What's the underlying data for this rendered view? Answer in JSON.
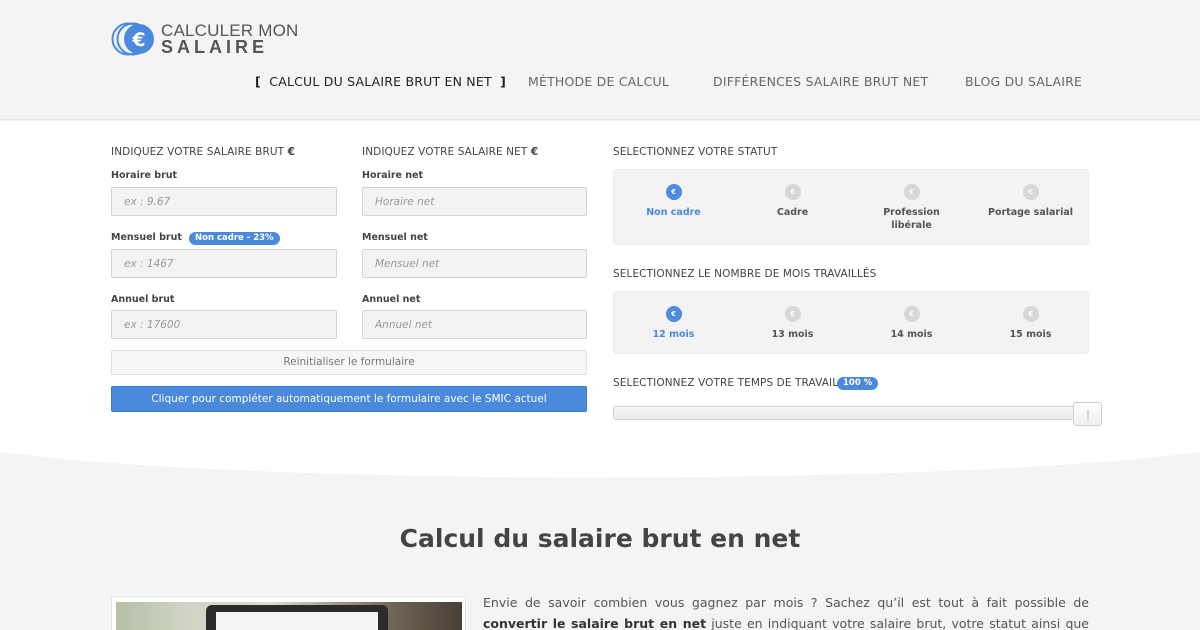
{
  "brand": {
    "line1": "CALCULER MON",
    "line2": "SALAIRE",
    "accent_color": "#4a89dc"
  },
  "nav": {
    "items": [
      {
        "label": "CALCUL DU SALAIRE BRUT EN NET",
        "active": true
      },
      {
        "label": "MÉTHODE DE CALCUL",
        "active": false
      },
      {
        "label": "DIFFÉRENCES SALAIRE BRUT NET",
        "active": false
      },
      {
        "label": "BLOG DU SALAIRE",
        "active": false
      }
    ],
    "bracket_open": "[",
    "bracket_close": "]"
  },
  "form": {
    "brut_title": "INDIQUEZ VOTRE SALAIRE BRUT",
    "net_title": "INDIQUEZ VOTRE SALAIRE NET",
    "euro_symbol": "€",
    "brut": {
      "horaire_label": "Horaire brut",
      "horaire_placeholder": "ex : 9.67",
      "horaire_value": "",
      "mensuel_label": "Mensuel brut",
      "mensuel_badge": "Non cadre - 23%",
      "mensuel_placeholder": "ex : 1467",
      "mensuel_value": "",
      "annuel_label": "Annuel brut",
      "annuel_placeholder": "ex : 17600",
      "annuel_value": ""
    },
    "net": {
      "horaire_label": "Horaire net",
      "horaire_placeholder": "Horaire net",
      "horaire_value": "",
      "mensuel_label": "Mensuel net",
      "mensuel_placeholder": "Mensuel net",
      "mensuel_value": "",
      "annuel_label": "Annuel net",
      "annuel_placeholder": "Annuel net",
      "annuel_value": ""
    },
    "reset_label": "Reinitialiser le formulaire",
    "smic_label": "Cliquer pour compléter automatiquement le formulaire avec le SMIC actuel"
  },
  "statut": {
    "title": "SELECTIONNEZ VOTRE STATUT",
    "options": [
      {
        "label": "Non cadre",
        "selected": true
      },
      {
        "label": "Cadre",
        "selected": false
      },
      {
        "label_line1": "Profession",
        "label_line2": "libérale",
        "selected": false
      },
      {
        "label": "Portage salarial",
        "selected": false
      }
    ]
  },
  "mois": {
    "title": "SELECTIONNEZ LE NOMBRE DE MOIS TRAVAILLÉS",
    "options": [
      {
        "label": "12 mois",
        "selected": true
      },
      {
        "label": "13 mois",
        "selected": false
      },
      {
        "label": "14 mois",
        "selected": false
      },
      {
        "label": "15 mois",
        "selected": false
      }
    ]
  },
  "temps": {
    "title": "SELECTIONNEZ VOTRE TEMPS DE TRAVAIL",
    "badge": "100 %",
    "value_percent": 100
  },
  "content": {
    "title": "Calcul du salaire brut en net",
    "para_1": "Envie de savoir combien vous gagnez par mois ? Sachez qu’il est tout à fait possible de ",
    "para_bold": "convertir le salaire brut en net",
    "para_2": " juste en indiquant votre salaire brut, votre statut ainsi que votre temps réel"
  },
  "radio_icon": "euro-icon"
}
